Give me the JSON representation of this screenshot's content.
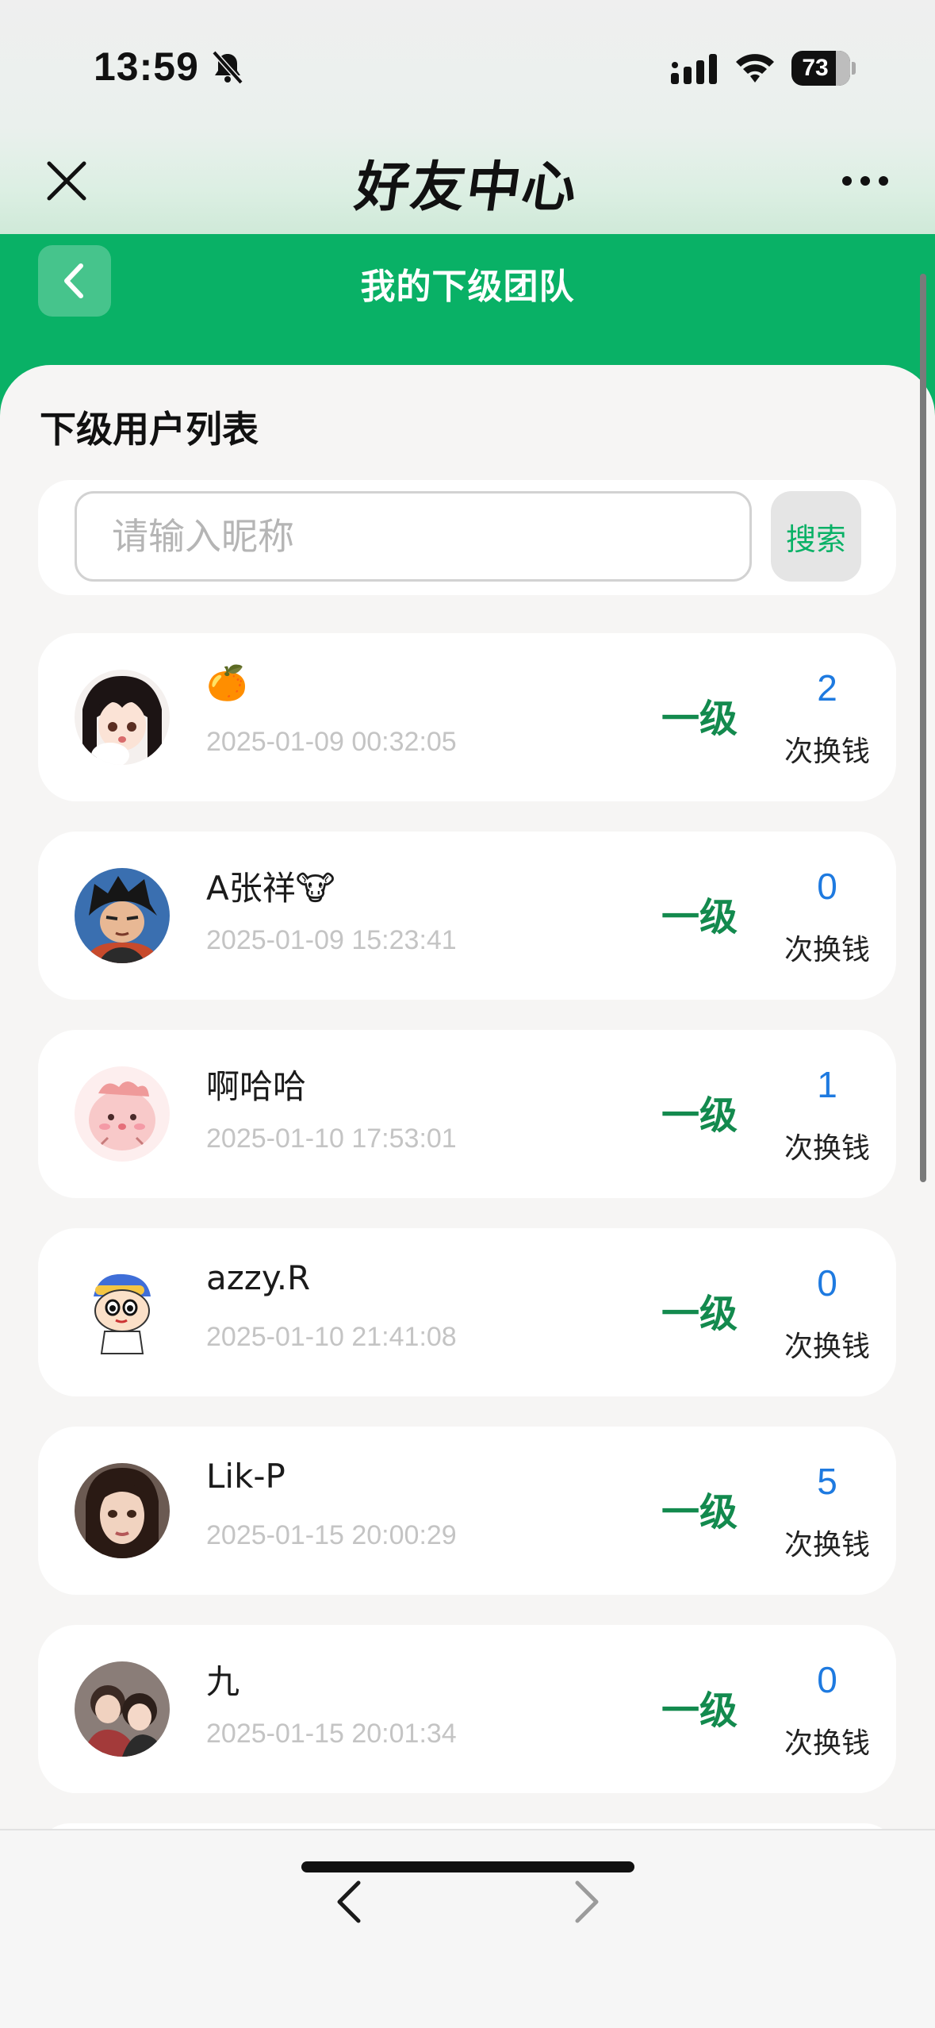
{
  "status_bar": {
    "time": "13:59",
    "battery": "73"
  },
  "mini_program": {
    "title": "好友中心"
  },
  "header": {
    "title": "我的下级团队"
  },
  "section": {
    "title": "下级用户列表"
  },
  "search": {
    "placeholder": "请输入昵称",
    "value": "",
    "button_label": "搜索"
  },
  "users": [
    {
      "name": "🍊",
      "date": "2025-01-09 00:32:05",
      "level": "一级",
      "count": "2",
      "count_label": "次换钱"
    },
    {
      "name": "A张祥🐮",
      "date": "2025-01-09 15:23:41",
      "level": "一级",
      "count": "0",
      "count_label": "次换钱"
    },
    {
      "name": "啊哈哈",
      "date": "2025-01-10 17:53:01",
      "level": "一级",
      "count": "1",
      "count_label": "次换钱"
    },
    {
      "name": "azzy.R",
      "date": "2025-01-10 21:41:08",
      "level": "一级",
      "count": "0",
      "count_label": "次换钱"
    },
    {
      "name": "Lik-P",
      "date": "2025-01-15 20:00:29",
      "level": "一级",
      "count": "5",
      "count_label": "次换钱"
    },
    {
      "name": "九",
      "date": "2025-01-15 20:01:34",
      "level": "一级",
      "count": "0",
      "count_label": "次换钱"
    }
  ],
  "colors": {
    "brand_green": "#09b166",
    "level_green": "#138a4e",
    "count_blue": "#1e7ae0"
  },
  "icons": [
    "bell-off-icon",
    "signal-icon",
    "wifi-icon",
    "close-icon",
    "more-icon",
    "chevron-left-icon",
    "nav-back-icon",
    "nav-forward-icon"
  ]
}
